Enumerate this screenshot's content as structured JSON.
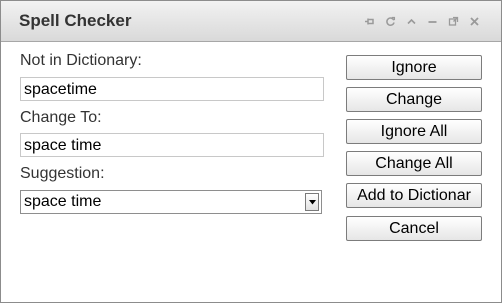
{
  "window": {
    "title": "Spell Checker",
    "controls": [
      "pin-icon",
      "refresh-icon",
      "collapse-icon",
      "minimize-icon",
      "maximize-icon",
      "close-icon"
    ]
  },
  "form": {
    "not_in_dictionary_label": "Not in Dictionary:",
    "not_in_dictionary_value": "spacetime",
    "change_to_label": "Change To:",
    "change_to_value": "space time",
    "suggestion_label": "Suggestion:",
    "suggestion_value": "space time"
  },
  "buttons": {
    "ignore": "Ignore",
    "change": "Change",
    "ignore_all": "Ignore All",
    "change_all": "Change All",
    "add_to_dictionary": "Add to Dictionar",
    "cancel": "Cancel"
  },
  "colors": {
    "titlebar_top": "#f2f2f2",
    "titlebar_bottom": "#d9d9d9",
    "border": "#8c8c8c",
    "text": "#333333"
  }
}
